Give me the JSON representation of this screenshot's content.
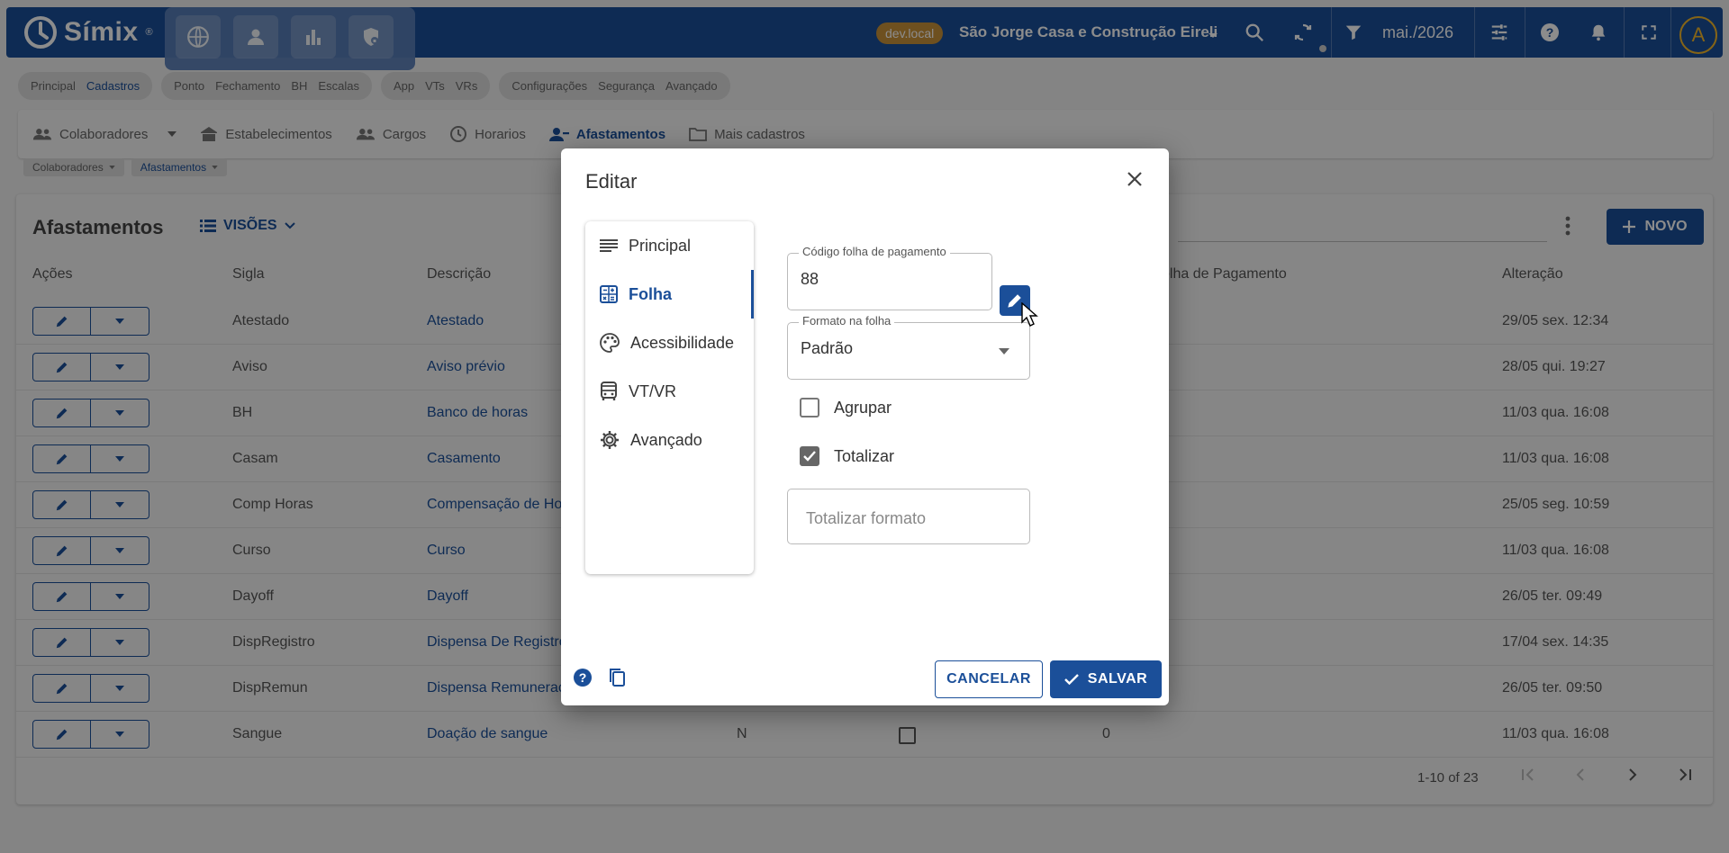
{
  "app": {
    "name": "Símix",
    "trademark": "®"
  },
  "topbar": {
    "env_badge": "dev.local",
    "company": "São Jorge Casa e Construção Eireli",
    "period": "mai./2026",
    "avatar_initial": "A",
    "quick_icons": [
      "globe-icon",
      "person-icon",
      "bar-chart-icon",
      "shield-lock-icon"
    ],
    "right_icons": [
      "search-icon",
      "sync-icon",
      "filter-icon",
      "tune-icon",
      "help-icon",
      "bell-icon",
      "fullscreen-icon"
    ]
  },
  "modnav": {
    "groups": [
      {
        "items": [
          "Principal",
          "Cadastros"
        ],
        "active": "Cadastros"
      },
      {
        "items": [
          "Ponto",
          "Fechamento",
          "BH",
          "Escalas"
        ]
      },
      {
        "items": [
          "App",
          "VTs",
          "VRs"
        ]
      },
      {
        "items": [
          "Configurações",
          "Segurança",
          "Avançado"
        ]
      }
    ]
  },
  "subnav": {
    "items": [
      {
        "label": "Colaboradores",
        "icon": "people-icon"
      },
      {
        "label": "Estabelecimentos",
        "icon": "store-icon"
      },
      {
        "label": "Cargos",
        "icon": "people-icon"
      },
      {
        "label": "Horarios",
        "icon": "clock-icon"
      },
      {
        "label": "Afastamentos",
        "icon": "person-remove-icon",
        "active": true
      },
      {
        "label": "Mais cadastros",
        "icon": "folder-icon"
      }
    ]
  },
  "breadcrumb": [
    "Colaboradores",
    "Afastamentos"
  ],
  "page": {
    "title": "Afastamentos",
    "views_label": "VISÕES",
    "new_label": "NOVO",
    "columns": {
      "acoes": "Ações",
      "sigla": "Sigla",
      "descricao": "Descrição",
      "folha": "olha de Pagamento",
      "alteracao": "Alteração"
    },
    "rows": [
      {
        "sigla": "Atestado",
        "descricao": "Atestado",
        "alteracao": "29/05 sex. 12:34"
      },
      {
        "sigla": "Aviso",
        "descricao": "Aviso prévio",
        "alteracao": "28/05 qui. 19:27"
      },
      {
        "sigla": "BH",
        "descricao": "Banco de horas",
        "alteracao": "11/03 qua. 16:08"
      },
      {
        "sigla": "Casam",
        "descricao": "Casamento",
        "alteracao": "11/03 qua. 16:08"
      },
      {
        "sigla": "Comp Horas",
        "descricao": "Compensação de Ho",
        "alteracao": "25/05 seg. 10:59"
      },
      {
        "sigla": "Curso",
        "descricao": "Curso",
        "alteracao": "11/03 qua. 16:08"
      },
      {
        "sigla": "Dayoff",
        "descricao": "Dayoff",
        "alteracao": "26/05 ter. 09:49"
      },
      {
        "sigla": "DispRegistro",
        "descricao": "Dispensa De Registro",
        "alteracao": "17/04 sex. 14:35"
      },
      {
        "sigla": "DispRemun",
        "descricao": "Dispensa Remunerac",
        "alteracao": "26/05 ter. 09:50"
      },
      {
        "sigla": "Sangue",
        "descricao": "Doação de sangue",
        "n": "N",
        "folha": "0",
        "alteracao": "11/03 qua. 16:08"
      }
    ],
    "pagination": "1-10 of 23"
  },
  "dialog": {
    "title": "Editar",
    "menu": [
      {
        "label": "Principal",
        "icon": "lines-icon"
      },
      {
        "label": "Folha",
        "icon": "calculator-icon",
        "active": true
      },
      {
        "label": "Acessibilidade",
        "icon": "palette-icon"
      },
      {
        "label": "VT/VR",
        "icon": "bus-icon"
      },
      {
        "label": "Avançado",
        "icon": "gear-icon"
      }
    ],
    "codigo": {
      "label": "Código folha de pagamento",
      "value": "88"
    },
    "formato": {
      "label": "Formato na folha",
      "value": "Padrão"
    },
    "agrupar": {
      "label": "Agrupar",
      "checked": false
    },
    "totalizar": {
      "label": "Totalizar",
      "checked": true
    },
    "totalizar_formato": {
      "placeholder": "Totalizar formato"
    },
    "cancel_label": "CANCELAR",
    "save_label": "SALVAR"
  },
  "colors": {
    "primary": "#1b4f99",
    "badge": "#c8923a",
    "avatar_ring": "#f2b72a"
  }
}
